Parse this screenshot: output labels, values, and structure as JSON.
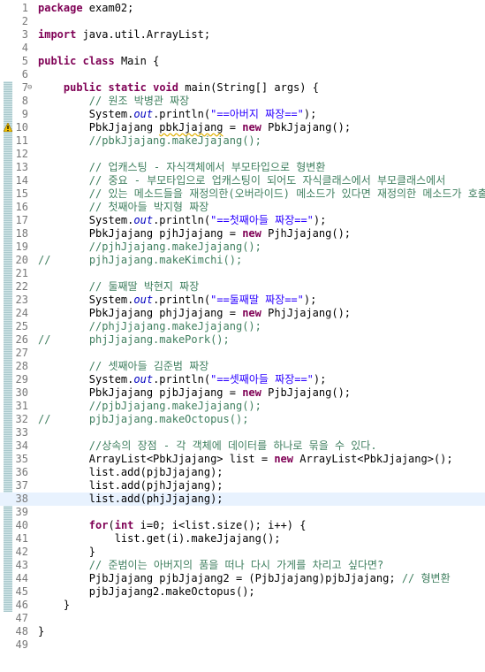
{
  "editor": {
    "lines": [
      {
        "num": "1",
        "tokens": [
          {
            "t": "package",
            "c": "k"
          },
          {
            "t": " exam02;"
          }
        ]
      },
      {
        "num": "2",
        "tokens": []
      },
      {
        "num": "3",
        "tokens": [
          {
            "t": "import",
            "c": "k"
          },
          {
            "t": " java.util.ArrayList;"
          }
        ]
      },
      {
        "num": "4",
        "tokens": []
      },
      {
        "num": "5",
        "tokens": [
          {
            "t": "public",
            "c": "k"
          },
          {
            "t": " "
          },
          {
            "t": "class",
            "c": "k"
          },
          {
            "t": " Main {"
          }
        ]
      },
      {
        "num": "6",
        "tokens": []
      },
      {
        "num": "7",
        "fold": true,
        "tokens": [
          {
            "t": "    "
          },
          {
            "t": "public",
            "c": "k"
          },
          {
            "t": " "
          },
          {
            "t": "static",
            "c": "k"
          },
          {
            "t": " "
          },
          {
            "t": "void",
            "c": "k"
          },
          {
            "t": " main(String[] args) {"
          }
        ]
      },
      {
        "num": "8",
        "tokens": [
          {
            "t": "        "
          },
          {
            "t": "// 원조 박병관 짜장",
            "c": "c"
          }
        ]
      },
      {
        "num": "9",
        "tokens": [
          {
            "t": "        System."
          },
          {
            "t": "out",
            "c": "f"
          },
          {
            "t": ".println("
          },
          {
            "t": "\"==아버지 짜장==\"",
            "c": "s"
          },
          {
            "t": ");"
          }
        ]
      },
      {
        "num": "10",
        "warn": true,
        "tokens": [
          {
            "t": "        PbkJjajang "
          },
          {
            "t": "pbkJjajang",
            "c": "u"
          },
          {
            "t": " = "
          },
          {
            "t": "new",
            "c": "k"
          },
          {
            "t": " PbkJjajang();"
          }
        ]
      },
      {
        "num": "11",
        "tokens": [
          {
            "t": "        "
          },
          {
            "t": "//pbkJjajang.makeJjajang();",
            "c": "c"
          }
        ]
      },
      {
        "num": "12",
        "tokens": []
      },
      {
        "num": "13",
        "tokens": [
          {
            "t": "        "
          },
          {
            "t": "// 업캐스팅 - 자식객체에서 부모타입으로 형변환",
            "c": "c"
          }
        ]
      },
      {
        "num": "14",
        "tokens": [
          {
            "t": "        "
          },
          {
            "t": "// 중요 - 부모타입으로 업캐스팅이 되어도 자식클래스에서 부모클래스에서",
            "c": "c"
          }
        ]
      },
      {
        "num": "15",
        "tokens": [
          {
            "t": "        "
          },
          {
            "t": "// 있는 메소드들을 재정의한(오버라이드) 메소드가 있다면 재정의한 메소드가 호출됨",
            "c": "c"
          }
        ]
      },
      {
        "num": "16",
        "tokens": [
          {
            "t": "        "
          },
          {
            "t": "// 첫째아들 박지형 짜장",
            "c": "c"
          }
        ]
      },
      {
        "num": "17",
        "tokens": [
          {
            "t": "        System."
          },
          {
            "t": "out",
            "c": "f"
          },
          {
            "t": ".println("
          },
          {
            "t": "\"==첫째아들 짜장==\"",
            "c": "s"
          },
          {
            "t": ");"
          }
        ]
      },
      {
        "num": "18",
        "tokens": [
          {
            "t": "        PbkJjajang pjhJjajang = "
          },
          {
            "t": "new",
            "c": "k"
          },
          {
            "t": " PjhJjajang();"
          }
        ]
      },
      {
        "num": "19",
        "tokens": [
          {
            "t": "        "
          },
          {
            "t": "//pjhJjajang.makeJjajang();",
            "c": "c"
          }
        ]
      },
      {
        "num": "20",
        "tokens": [
          {
            "t": "//",
            "c": "c"
          },
          {
            "t": "      "
          },
          {
            "t": "pjhJjajang.makeKimchi();",
            "c": "c"
          }
        ]
      },
      {
        "num": "21",
        "tokens": []
      },
      {
        "num": "22",
        "tokens": [
          {
            "t": "        "
          },
          {
            "t": "// 둘째딸 박현지 짜장",
            "c": "c"
          }
        ]
      },
      {
        "num": "23",
        "tokens": [
          {
            "t": "        System."
          },
          {
            "t": "out",
            "c": "f"
          },
          {
            "t": ".println("
          },
          {
            "t": "\"==둘째딸 짜장==\"",
            "c": "s"
          },
          {
            "t": ");"
          }
        ]
      },
      {
        "num": "24",
        "tokens": [
          {
            "t": "        PbkJjajang phjJjajang = "
          },
          {
            "t": "new",
            "c": "k"
          },
          {
            "t": " PhjJjajang();"
          }
        ]
      },
      {
        "num": "25",
        "tokens": [
          {
            "t": "        "
          },
          {
            "t": "//phjJjajang.makeJjajang();",
            "c": "c"
          }
        ]
      },
      {
        "num": "26",
        "tokens": [
          {
            "t": "//",
            "c": "c"
          },
          {
            "t": "      "
          },
          {
            "t": "phjJjajang.makePork();",
            "c": "c"
          }
        ]
      },
      {
        "num": "27",
        "tokens": []
      },
      {
        "num": "28",
        "tokens": [
          {
            "t": "        "
          },
          {
            "t": "// 셋째아들 김준범 짜장",
            "c": "c"
          }
        ]
      },
      {
        "num": "29",
        "tokens": [
          {
            "t": "        System."
          },
          {
            "t": "out",
            "c": "f"
          },
          {
            "t": ".println("
          },
          {
            "t": "\"==셋째아들 짜장==\"",
            "c": "s"
          },
          {
            "t": ");"
          }
        ]
      },
      {
        "num": "30",
        "tokens": [
          {
            "t": "        PbkJjajang pjbJjajang = "
          },
          {
            "t": "new",
            "c": "k"
          },
          {
            "t": " PjbJjajang();"
          }
        ]
      },
      {
        "num": "31",
        "tokens": [
          {
            "t": "        "
          },
          {
            "t": "//pjbJjajang.makeJjajang();",
            "c": "c"
          }
        ]
      },
      {
        "num": "32",
        "tokens": [
          {
            "t": "//",
            "c": "c"
          },
          {
            "t": "      "
          },
          {
            "t": "pjbJjajang.makeOctopus();",
            "c": "c"
          }
        ]
      },
      {
        "num": "33",
        "tokens": []
      },
      {
        "num": "34",
        "tokens": [
          {
            "t": "        "
          },
          {
            "t": "//상속의 장점 - 각 객체에 데이터를 하나로 묶을 수 있다.",
            "c": "c"
          }
        ]
      },
      {
        "num": "35",
        "tokens": [
          {
            "t": "        ArrayList<PbkJjajang> list = "
          },
          {
            "t": "new",
            "c": "k"
          },
          {
            "t": " ArrayList<PbkJjajang>();"
          }
        ]
      },
      {
        "num": "36",
        "tokens": [
          {
            "t": "        list.add(pjbJjajang);"
          }
        ]
      },
      {
        "num": "37",
        "tokens": [
          {
            "t": "        list.add(pjhJjajang);"
          }
        ]
      },
      {
        "num": "38",
        "current": true,
        "tokens": [
          {
            "t": "        list.add(phjJjajang);"
          }
        ]
      },
      {
        "num": "39",
        "tokens": []
      },
      {
        "num": "40",
        "tokens": [
          {
            "t": "        "
          },
          {
            "t": "for",
            "c": "k"
          },
          {
            "t": "("
          },
          {
            "t": "int",
            "c": "k"
          },
          {
            "t": " i=0; i<list.size(); i++) {"
          }
        ]
      },
      {
        "num": "41",
        "tokens": [
          {
            "t": "            list.get(i).makeJjajang();"
          }
        ]
      },
      {
        "num": "42",
        "tokens": [
          {
            "t": "        }"
          }
        ]
      },
      {
        "num": "43",
        "tokens": [
          {
            "t": "        "
          },
          {
            "t": "// 준범이는 아버지의 품을 떠나 다시 가게를 차리고 싶다면?",
            "c": "c"
          }
        ]
      },
      {
        "num": "44",
        "tokens": [
          {
            "t": "        PjbJjajang pjbJjajang2 = (PjbJjajang)pjbJjajang; "
          },
          {
            "t": "// 형변환",
            "c": "c"
          }
        ]
      },
      {
        "num": "45",
        "tokens": [
          {
            "t": "        pjbJjajang2.makeOctopus();"
          }
        ]
      },
      {
        "num": "46",
        "tokens": [
          {
            "t": "    }"
          }
        ]
      },
      {
        "num": "47",
        "tokens": []
      },
      {
        "num": "48",
        "tokens": [
          {
            "t": "}"
          }
        ]
      },
      {
        "num": "49",
        "tokens": []
      }
    ]
  }
}
